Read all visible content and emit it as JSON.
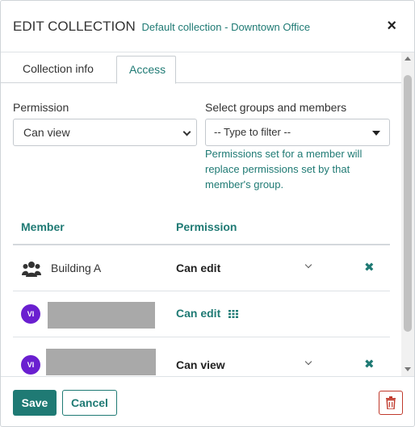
{
  "header": {
    "title": "EDIT COLLECTION",
    "subtitle": "Default collection - Downtown Office",
    "close_icon": "close-icon"
  },
  "tabs": [
    {
      "label": "Collection info",
      "active": false
    },
    {
      "label": "Access",
      "active": true
    }
  ],
  "form": {
    "permission_label": "Permission",
    "permission_value": "Can view",
    "groups_label": "Select groups and members",
    "groups_placeholder": "-- Type to filter --",
    "help_text": "Permissions set for a member will replace permissions set by that member's group."
  },
  "table": {
    "columns": [
      "Member",
      "Permission"
    ],
    "rows": [
      {
        "type": "group",
        "icon": "group-icon",
        "name": "Building A",
        "permission": "Can edit",
        "has_dropdown": true,
        "removable": true
      },
      {
        "type": "user",
        "avatar": "VI",
        "name_redacted": true,
        "permission": "Can edit",
        "permission_icon": "grid-icon",
        "has_dropdown": false,
        "removable": false
      },
      {
        "type": "user",
        "avatar": "VI",
        "name_redacted": true,
        "permission": "Can view",
        "has_dropdown": true,
        "removable": true
      }
    ]
  },
  "footer": {
    "save_label": "Save",
    "cancel_label": "Cancel",
    "delete_icon": "trash-icon"
  },
  "colors": {
    "accent": "#1f7a74",
    "avatar": "#6a1fd0",
    "danger": "#c0392b",
    "redaction": "#a9a9a9"
  }
}
